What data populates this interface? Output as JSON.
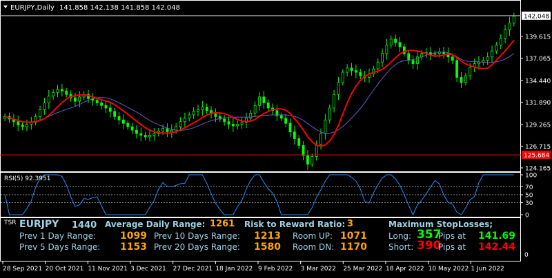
{
  "chart_header": {
    "symbol_text": "EURJPY,Daily",
    "ohlc_text": "141.858 142.138 141.858 142.048"
  },
  "price_axis": {
    "labels": [
      "142.048",
      "139.615",
      "137.065",
      "134.440",
      "131.890",
      "129.265",
      "126.715",
      "125.684",
      "124.165"
    ],
    "current_price": "142.048",
    "line_price": "125.684"
  },
  "date_axis": {
    "labels": [
      "28 Sep 2021",
      "20 Oct 2021",
      "11 Nov 2021",
      "3 Dec 2021",
      "27 Dec 2021",
      "18 Jan 2022",
      "9 Feb 2022",
      "3 Mar 2022",
      "25 Mar 2022",
      "18 Apr 2022",
      "10 May 2022",
      "1 Jun 2022"
    ]
  },
  "rsi_panel": {
    "label": "RSI(5) 92.3951",
    "levels": [
      "100",
      "70",
      "50",
      "30",
      "0"
    ],
    "level_values": [
      70,
      50,
      30
    ]
  },
  "tsr_panel": {
    "panel_label": "TSR",
    "symbol": "EURJPY",
    "timeframe": "1440",
    "adr_label": "Average Daily Range:",
    "adr_value": "1261",
    "rr_label": "Risk to Reward Ratio:",
    "rr_value": "3",
    "max_sl_label": "Maximum  StopLosses;",
    "prev1_label": "Prev 1 Day Range:",
    "prev1_value": "1099",
    "prev5_label": "Prev 5 Days Range:",
    "prev5_value": "1153",
    "prev10_label": "Prev 10 Days Range:",
    "prev10_value": "1213",
    "prev20_label": "Prev 20 Days Range:",
    "prev20_value": "1580",
    "room_up_label": "Room UP:",
    "room_up_value": "1071",
    "room_dn_label": "Room DN:",
    "room_dn_value": "1170",
    "long_label": "Long:",
    "long_value": "357",
    "long_pips_label": "Pips at",
    "long_price": "141.69",
    "short_label": "Short:",
    "short_value": "390",
    "short_pips_label": "Pips at",
    "short_price": "142.44",
    "axis_zero": "0"
  },
  "colors": {
    "background": "#000000",
    "bull_candle": "#00ff00",
    "bear_candle": "#00ff00",
    "ma_fast": "#ff0000",
    "ma_slow": "#6a5acd",
    "rsi_line": "#1e90ff",
    "hline": "#ff0000",
    "tsr_title": "#9fd3e6",
    "tsr_value": "#ffa500",
    "tsr_green": "#00ff00",
    "tsr_red": "#ff0000"
  },
  "chart_data": {
    "type": "candlestick",
    "series": [
      {
        "name": "EURJPY,Daily",
        "values": [
          130.2,
          129.9,
          129.6,
          129.2,
          129.0,
          129.3,
          129.5,
          130.2,
          131.0,
          131.8,
          132.6,
          133.0,
          133.4,
          133.2,
          132.8,
          132.4,
          132.0,
          132.5,
          132.8,
          132.3,
          132.1,
          131.8,
          131.5,
          131.2,
          130.8,
          130.2,
          129.8,
          129.4,
          129.0,
          128.6,
          128.2,
          128.0,
          127.8,
          128.0,
          128.2,
          128.5,
          128.8,
          128.4,
          128.6,
          129.0,
          129.6,
          130.0,
          130.4,
          130.8,
          131.0,
          131.3,
          130.9,
          130.5,
          130.2,
          129.9,
          129.6,
          129.3,
          129.1,
          129.3,
          129.5,
          130.0,
          130.6,
          131.5,
          132.5,
          131.8,
          131.2,
          130.9,
          130.3,
          130.0,
          129.4,
          128.4,
          127.6,
          126.8,
          125.6,
          124.6,
          125.5,
          126.9,
          128.2,
          129.8,
          131.2,
          132.8,
          134.2,
          135.4,
          135.9,
          135.6,
          135.4,
          135.0,
          134.8,
          135.2,
          135.8,
          136.6,
          137.6,
          138.6,
          139.3,
          138.9,
          138.4,
          137.6,
          136.8,
          136.4,
          137.2,
          137.6,
          137.7,
          137.5,
          137.6,
          137.8,
          137.6,
          137.2,
          136.8,
          134.8,
          134.2,
          135.0,
          136.0,
          136.4,
          136.6,
          136.8,
          137.2,
          137.9,
          138.6,
          139.4,
          140.4,
          141.2,
          142.0
        ]
      },
      {
        "name": "MA fast"
      },
      {
        "name": "MA slow"
      }
    ],
    "xlabels": [
      "28 Sep 2021",
      "20 Oct 2021",
      "11 Nov 2021",
      "3 Dec 2021",
      "27 Dec 2021",
      "18 Jan 2022",
      "9 Feb 2022",
      "3 Mar 2022",
      "25 Mar 2022",
      "18 Apr 2022",
      "10 May 2022",
      "1 Jun 2022"
    ],
    "ylim": [
      124.0,
      142.6
    ]
  }
}
